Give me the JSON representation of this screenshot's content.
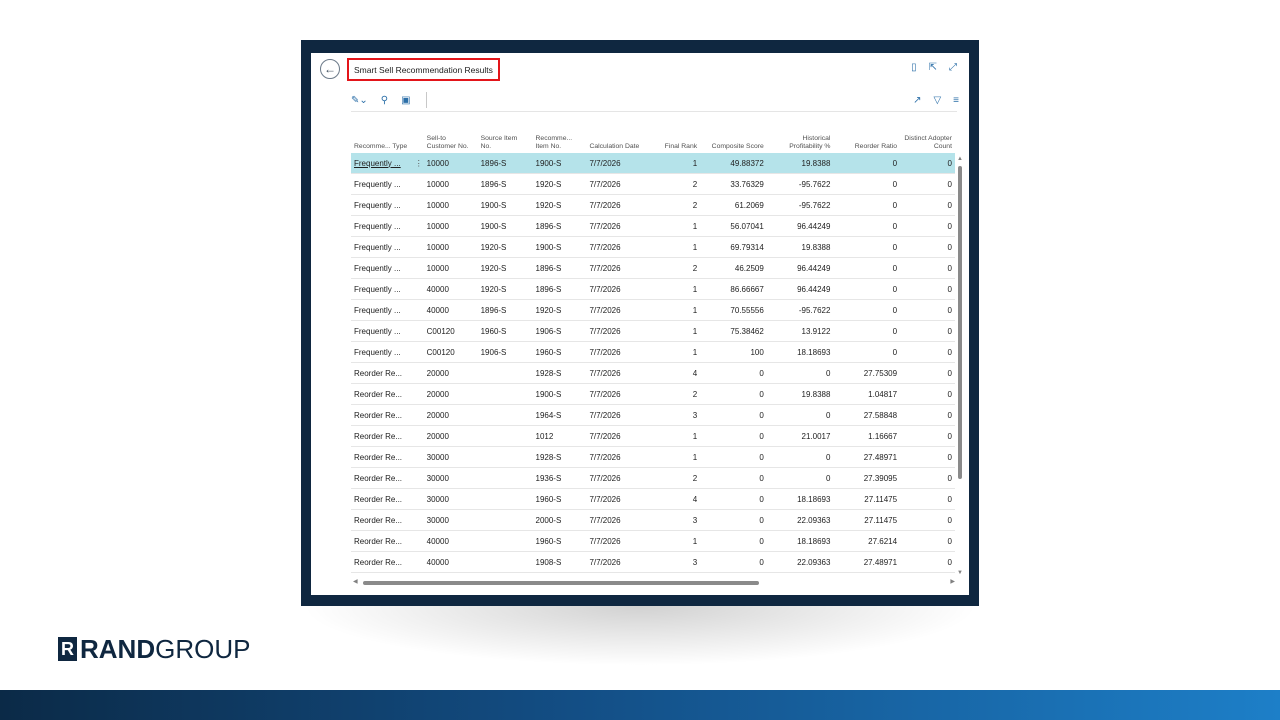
{
  "page": {
    "title": "Smart Sell Recommendation Results",
    "back_icon": "←"
  },
  "columns": [
    "Recomme... Type",
    "Sell-to Customer No.",
    "Source Item No.",
    "Recomme... Item No.",
    "Calculation Date",
    "Final Rank",
    "Composite Score",
    "Historical Profitability %",
    "Reorder Ratio",
    "Distinct Adopter Count"
  ],
  "rows": [
    [
      "Frequently ...",
      "10000",
      "1896-S",
      "1900-S",
      "7/7/2026",
      "1",
      "49.88372",
      "19.8388",
      "0",
      "0"
    ],
    [
      "Frequently ...",
      "10000",
      "1896-S",
      "1920-S",
      "7/7/2026",
      "2",
      "33.76329",
      "-95.7622",
      "0",
      "0"
    ],
    [
      "Frequently ...",
      "10000",
      "1900-S",
      "1920-S",
      "7/7/2026",
      "2",
      "61.2069",
      "-95.7622",
      "0",
      "0"
    ],
    [
      "Frequently ...",
      "10000",
      "1900-S",
      "1896-S",
      "7/7/2026",
      "1",
      "56.07041",
      "96.44249",
      "0",
      "0"
    ],
    [
      "Frequently ...",
      "10000",
      "1920-S",
      "1900-S",
      "7/7/2026",
      "1",
      "69.79314",
      "19.8388",
      "0",
      "0"
    ],
    [
      "Frequently ...",
      "10000",
      "1920-S",
      "1896-S",
      "7/7/2026",
      "2",
      "46.2509",
      "96.44249",
      "0",
      "0"
    ],
    [
      "Frequently ...",
      "40000",
      "1920-S",
      "1896-S",
      "7/7/2026",
      "1",
      "86.66667",
      "96.44249",
      "0",
      "0"
    ],
    [
      "Frequently ...",
      "40000",
      "1896-S",
      "1920-S",
      "7/7/2026",
      "1",
      "70.55556",
      "-95.7622",
      "0",
      "0"
    ],
    [
      "Frequently ...",
      "C00120",
      "1960-S",
      "1906-S",
      "7/7/2026",
      "1",
      "75.38462",
      "13.9122",
      "0",
      "0"
    ],
    [
      "Frequently ...",
      "C00120",
      "1906-S",
      "1960-S",
      "7/7/2026",
      "1",
      "100",
      "18.18693",
      "0",
      "0"
    ],
    [
      "Reorder Re...",
      "20000",
      "",
      "1928-S",
      "7/7/2026",
      "4",
      "0",
      "0",
      "27.75309",
      "0"
    ],
    [
      "Reorder Re...",
      "20000",
      "",
      "1900-S",
      "7/7/2026",
      "2",
      "0",
      "19.8388",
      "1.04817",
      "0"
    ],
    [
      "Reorder Re...",
      "20000",
      "",
      "1964-S",
      "7/7/2026",
      "3",
      "0",
      "0",
      "27.58848",
      "0"
    ],
    [
      "Reorder Re...",
      "20000",
      "",
      "1012",
      "7/7/2026",
      "1",
      "0",
      "21.0017",
      "1.16667",
      "0"
    ],
    [
      "Reorder Re...",
      "30000",
      "",
      "1928-S",
      "7/7/2026",
      "1",
      "0",
      "0",
      "27.48971",
      "0"
    ],
    [
      "Reorder Re...",
      "30000",
      "",
      "1936-S",
      "7/7/2026",
      "2",
      "0",
      "0",
      "27.39095",
      "0"
    ],
    [
      "Reorder Re...",
      "30000",
      "",
      "1960-S",
      "7/7/2026",
      "4",
      "0",
      "18.18693",
      "27.11475",
      "0"
    ],
    [
      "Reorder Re...",
      "30000",
      "",
      "2000-S",
      "7/7/2026",
      "3",
      "0",
      "22.09363",
      "27.11475",
      "0"
    ],
    [
      "Reorder Re...",
      "40000",
      "",
      "1960-S",
      "7/7/2026",
      "1",
      "0",
      "18.18693",
      "27.6214",
      "0"
    ],
    [
      "Reorder Re...",
      "40000",
      "",
      "1908-S",
      "7/7/2026",
      "3",
      "0",
      "22.09363",
      "27.48971",
      "0"
    ]
  ],
  "selected_row": 0,
  "row_menu_icon": "⋮",
  "logo": {
    "mark": "R",
    "rand": "RAND",
    "group": "GROUP"
  },
  "colors": {
    "frame": "#0f2740",
    "highlight": "#e3151a",
    "selected_row": "#b5e3ea",
    "accent": "#2c6fa8"
  }
}
